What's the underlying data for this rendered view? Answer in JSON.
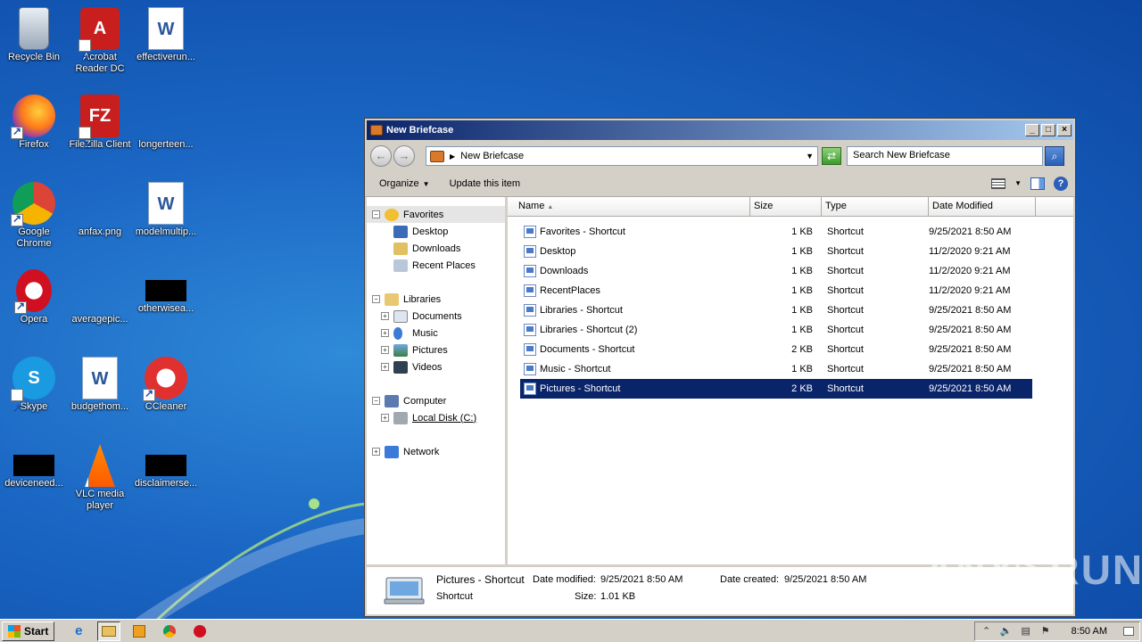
{
  "desktop": {
    "icons": [
      {
        "label": "Recycle Bin",
        "icon": "recycle-bin-icon"
      },
      {
        "label": "Acrobat Reader DC",
        "icon": "acrobat-icon"
      },
      {
        "label": "effectiverun...",
        "icon": "word-doc-icon"
      },
      {
        "label": "Firefox",
        "icon": "firefox-icon"
      },
      {
        "label": "FileZilla Client",
        "icon": "filezilla-icon"
      },
      {
        "label": "longerteen...",
        "icon": "file-icon"
      },
      {
        "label": "Google Chrome",
        "icon": "chrome-icon"
      },
      {
        "label": "anfax.png",
        "icon": "file-icon"
      },
      {
        "label": "modelmultip...",
        "icon": "word-doc-icon"
      },
      {
        "label": "Opera",
        "icon": "opera-icon"
      },
      {
        "label": "averagepic...",
        "icon": "file-icon"
      },
      {
        "label": "otherwisea...",
        "icon": "black-file-icon"
      },
      {
        "label": "Skype",
        "icon": "skype-icon"
      },
      {
        "label": "budgethom...",
        "icon": "word-doc-icon"
      },
      {
        "label": "CCleaner",
        "icon": "ccleaner-icon"
      },
      {
        "label": "deviceneed...",
        "icon": "black-file-icon"
      },
      {
        "label": "VLC media player",
        "icon": "vlc-icon"
      },
      {
        "label": "disclaimerse...",
        "icon": "black-file-icon"
      }
    ]
  },
  "window": {
    "title": "New Briefcase",
    "address": "New Briefcase",
    "search_placeholder": "Search New Briefcase",
    "toolbar": {
      "organize": "Organize",
      "update": "Update this item"
    },
    "nav": {
      "favorites": "Favorites",
      "desktop": "Desktop",
      "downloads": "Downloads",
      "recent_places": "Recent Places",
      "libraries": "Libraries",
      "documents": "Documents",
      "music": "Music",
      "pictures": "Pictures",
      "videos": "Videos",
      "computer": "Computer",
      "local_disk": "Local Disk (C:)",
      "network": "Network"
    },
    "columns": {
      "name": "Name",
      "size": "Size",
      "type": "Type",
      "date": "Date Modified"
    },
    "files": [
      {
        "name": "Favorites - Shortcut",
        "size": "1 KB",
        "type": "Shortcut",
        "date": "9/25/2021 8:50 AM"
      },
      {
        "name": "Desktop",
        "size": "1 KB",
        "type": "Shortcut",
        "date": "11/2/2020 9:21 AM"
      },
      {
        "name": "Downloads",
        "size": "1 KB",
        "type": "Shortcut",
        "date": "11/2/2020 9:21 AM"
      },
      {
        "name": "RecentPlaces",
        "size": "1 KB",
        "type": "Shortcut",
        "date": "11/2/2020 9:21 AM"
      },
      {
        "name": "Libraries - Shortcut",
        "size": "1 KB",
        "type": "Shortcut",
        "date": "9/25/2021 8:50 AM"
      },
      {
        "name": "Libraries - Shortcut (2)",
        "size": "1 KB",
        "type": "Shortcut",
        "date": "9/25/2021 8:50 AM"
      },
      {
        "name": "Documents - Shortcut",
        "size": "2 KB",
        "type": "Shortcut",
        "date": "9/25/2021 8:50 AM"
      },
      {
        "name": "Music - Shortcut",
        "size": "1 KB",
        "type": "Shortcut",
        "date": "9/25/2021 8:50 AM"
      },
      {
        "name": "Pictures - Shortcut",
        "size": "2 KB",
        "type": "Shortcut",
        "date": "9/25/2021 8:50 AM"
      }
    ],
    "details": {
      "name": "Pictures - Shortcut",
      "type": "Shortcut",
      "date_modified_label": "Date modified:",
      "date_modified": "9/25/2021 8:50 AM",
      "size_label": "Size:",
      "size": "1.01 KB",
      "date_created_label": "Date created:",
      "date_created": "9/25/2021 8:50 AM"
    }
  },
  "watermark": "ANY▷RUN",
  "taskbar": {
    "start": "Start",
    "clock": "8:50 AM"
  },
  "colors": {
    "selection": "#0a246a",
    "title_start": "#0a246a",
    "title_end": "#a6caf0"
  }
}
